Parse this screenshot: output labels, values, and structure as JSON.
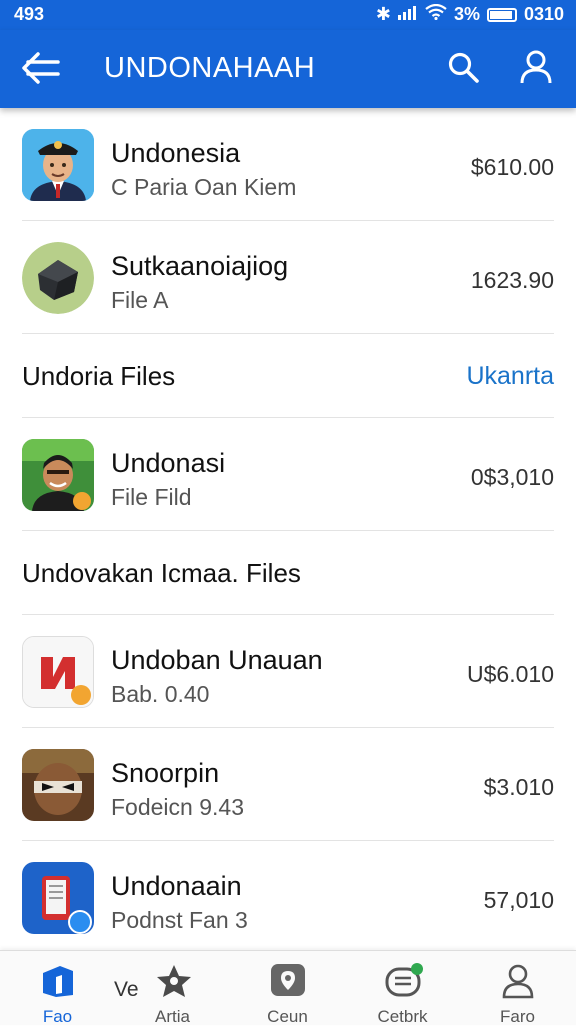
{
  "status": {
    "time": "493",
    "battery_pct": "3%",
    "right_time": "0310"
  },
  "appbar": {
    "title": "UNDONAHAAH"
  },
  "list": {
    "rows": [
      {
        "name": "Undonesia",
        "sub": "C Paria Oan Kiem",
        "price": "$610.00"
      },
      {
        "name": "Sutkaanoiajiog",
        "sub": "File A",
        "price": "1623.90"
      },
      {
        "name": "Undonasi",
        "sub": "File Fild",
        "price": "0$3,010"
      },
      {
        "name": "Undoban Unauan",
        "sub": "Bab. 0.40",
        "price": "U$6.010"
      },
      {
        "name": "Snoorpin",
        "sub": "Fodeicn 9.43",
        "price": "$3.010"
      },
      {
        "name": "Undonaain",
        "sub": "Podnst Fan 3",
        "price": "57,010"
      }
    ],
    "section1": {
      "title": "Undoria Files",
      "action": "Ukanrta"
    },
    "section2": {
      "title": "Undovakan Icmaa. Files"
    }
  },
  "ve_label": "Ve",
  "nav": [
    {
      "label": "Fao",
      "icon": "home-icon",
      "active": true
    },
    {
      "label": "Artia",
      "icon": "star-icon"
    },
    {
      "label": "Ceun",
      "icon": "pin-icon"
    },
    {
      "label": "Cetbrk",
      "icon": "message-icon"
    },
    {
      "label": "Faro",
      "icon": "person-icon"
    }
  ],
  "colors": {
    "primary": "#1565d8",
    "accent_link": "#1a73c9"
  }
}
